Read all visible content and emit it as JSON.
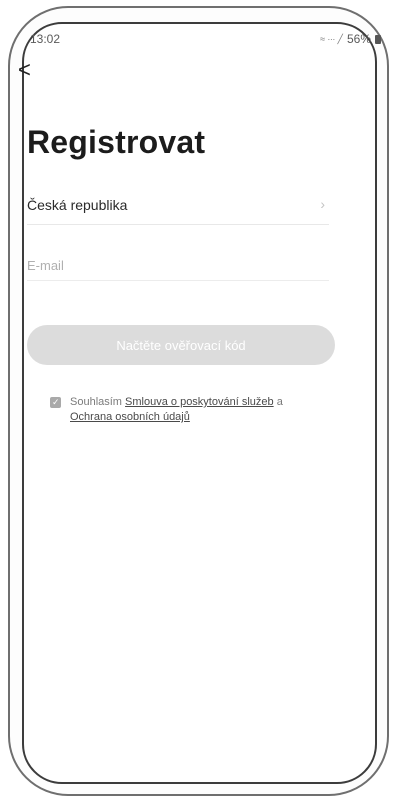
{
  "status_bar": {
    "time": "13:02",
    "signal_text": "≈ ∙∙∙ ╱",
    "battery_percent": "56%",
    "icons": [
      "wifi-icon",
      "signal-icon",
      "battery-icon"
    ]
  },
  "header": {
    "back_glyph": "<",
    "title": "Registrovat"
  },
  "form": {
    "country_label": "Česká republika",
    "email_placeholder": "E-mail",
    "email_value": "",
    "verify_button_label": "Načtěte ověřovací kód"
  },
  "agreement": {
    "checked": true,
    "prefix": "Souhlasím",
    "link_terms": "Smlouva o poskytování služeb",
    "conjunction": "a",
    "link_privacy": "Ochrana osobních údajů"
  },
  "colors": {
    "button_disabled": "#dcdcdc",
    "text_dark": "#1c1c1c",
    "text_muted": "#b0b0b0"
  }
}
